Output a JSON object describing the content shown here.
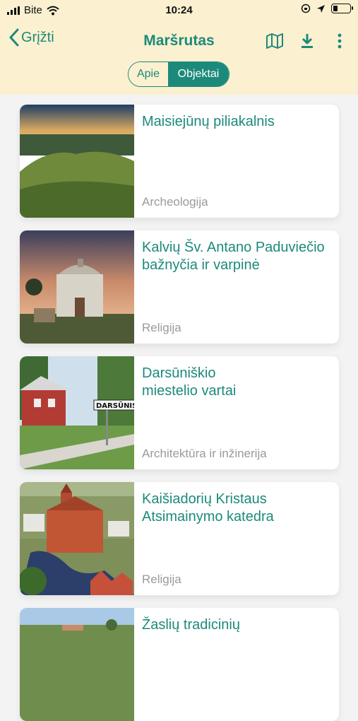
{
  "status": {
    "carrier": "Bite",
    "time": "10:24"
  },
  "nav": {
    "back_label": "Grįžti",
    "title": "Maršrutas"
  },
  "tabs": [
    {
      "label": "Apie"
    },
    {
      "label": "Objektai"
    }
  ],
  "items": [
    {
      "title": "Maisiejūnų piliakalnis",
      "category": "Archeologija"
    },
    {
      "title": "Kalvių Šv. Antano Paduviečio bažnyčia ir varpinė",
      "category": "Religija"
    },
    {
      "title": "Darsūniškio miestelio vartai",
      "category": "Architektūra ir inžinerija",
      "sign_text": "DARSŪNIS"
    },
    {
      "title": "Kaišiadorių Kristaus Atsimainymo katedra",
      "category": "Religija"
    },
    {
      "title": "Žaslių tradicinių",
      "category": ""
    }
  ],
  "colors": {
    "accent": "#1c8a7b",
    "header_bg": "#fbf0cf",
    "category": "#9a9a9a"
  }
}
